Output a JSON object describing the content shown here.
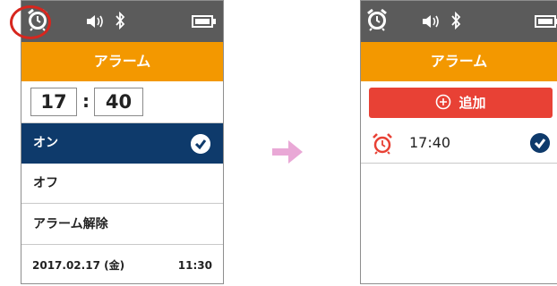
{
  "colors": {
    "statusbar": "#5b5b5b",
    "titlebar": "#f39800",
    "selected_row": "#0e3a6b",
    "add_button": "#e84135",
    "highlight_ring": "#d7261e",
    "arrow": "#e9a8d6"
  },
  "left_screen": {
    "statusbar_icons": [
      "alarm-clock-icon",
      "speaker-icon",
      "bluetooth-icon",
      "battery-icon"
    ],
    "title": "アラーム",
    "time": {
      "hour": "17",
      "separator": ":",
      "minute": "40"
    },
    "options": [
      {
        "label": "オン",
        "selected": true,
        "icon": "check-icon"
      },
      {
        "label": "オフ",
        "selected": false
      },
      {
        "label": "アラーム解除",
        "selected": false
      }
    ],
    "footer": {
      "date": "2017.02.17 (金)",
      "time": "11:30"
    }
  },
  "right_screen": {
    "statusbar_icons": [
      "alarm-clock-icon",
      "speaker-icon",
      "bluetooth-icon",
      "battery-icon"
    ],
    "title": "アラーム",
    "add_button": {
      "icon": "plus-circle-icon",
      "label": "追加"
    },
    "alarms": [
      {
        "icon": "alarm-clock-icon",
        "time": "17:40",
        "enabled": true
      }
    ]
  },
  "transition_arrow_icon": "right-arrow-icon"
}
